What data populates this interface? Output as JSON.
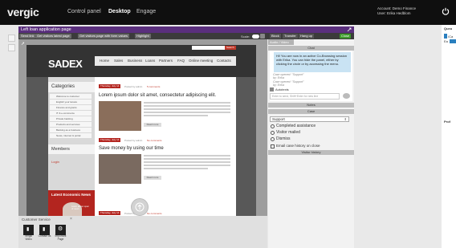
{
  "topbar": {
    "logo": "vergic",
    "nav": [
      "Control panel",
      "Desktop",
      "Engage"
    ],
    "active_nav": "Desktop",
    "account_line": "Account: Demo Finance",
    "user_line": "User: Erika Hedblom"
  },
  "session": {
    "title": "Left loan application page",
    "toolbar": [
      "Send link",
      "Get visitors latest page",
      "Get visitors page with form values",
      "Highlight"
    ],
    "scale_label": "Scale:",
    "actions": [
      "Block",
      "Transfer",
      "Hang up"
    ],
    "close_label": "Close",
    "av_tab": "Audio / Video"
  },
  "website": {
    "brand": "SADEX",
    "search_button": "Search",
    "nav": [
      "Home",
      "Sales",
      "Business",
      "Loans",
      "Partners",
      "FAQ",
      "Online meeting",
      "Contacts"
    ],
    "categories_title": "Categories",
    "categories": [
      "Welcome to customer",
      "English your leisure",
      "Finance and grants",
      "IT & e-commerce",
      "Private banking",
      "Products and services",
      "Banking as a business",
      "News, internet & portal"
    ],
    "members_title": "Members",
    "members_link": "Login",
    "news_title": "Latest Economic News",
    "news_caption": "Learn about open of news",
    "articles": [
      {
        "date": "Thursday, July 14",
        "posted": "Posted by admin",
        "comments": "5 comments",
        "title": "Lorem ipsum dolor sit amet, consectetur adipiscing elit.",
        "read_more": "Read more"
      },
      {
        "date": "Thursday, July 14",
        "posted": "Posted by admin",
        "comments": "No comments",
        "title": "Save money by using our time",
        "read_more": "Read more"
      },
      {
        "date": "Thursday, July 14",
        "posted": "Posted by admin",
        "comments": "No comments"
      }
    ]
  },
  "chat": {
    "header": "Chat",
    "message": "Hi! You are now in an active Co-Browsing session with Erika. You can hide the panel, either by clicking the circle or by accessing the menu.",
    "system_lines": [
      "Case opened: \"Support\"",
      "by: Erika",
      "Case opened: \"Support\"",
      "by: Erika"
    ],
    "autotexts": "Autotexts",
    "input_placeholder": "Enter to send, Shift+Enter for new line"
  },
  "notes_header": "Notes",
  "case": {
    "header": "Case",
    "selected": "Support",
    "options": [
      "Completed assistance",
      "Visitor mailed",
      "Dismiss"
    ],
    "email_label": "Email case history on close",
    "history_header": "Visitor history"
  },
  "customer_service": {
    "title": "Customer Service",
    "close": "×",
    "buttons": [
      "Vergic Video",
      "Contact us",
      "Important Page"
    ]
  },
  "right_panel": {
    "queue_title": "Queu",
    "queue_line": "/Ca",
    "queue_sub": "Ea",
    "profile_title": "Prof"
  }
}
